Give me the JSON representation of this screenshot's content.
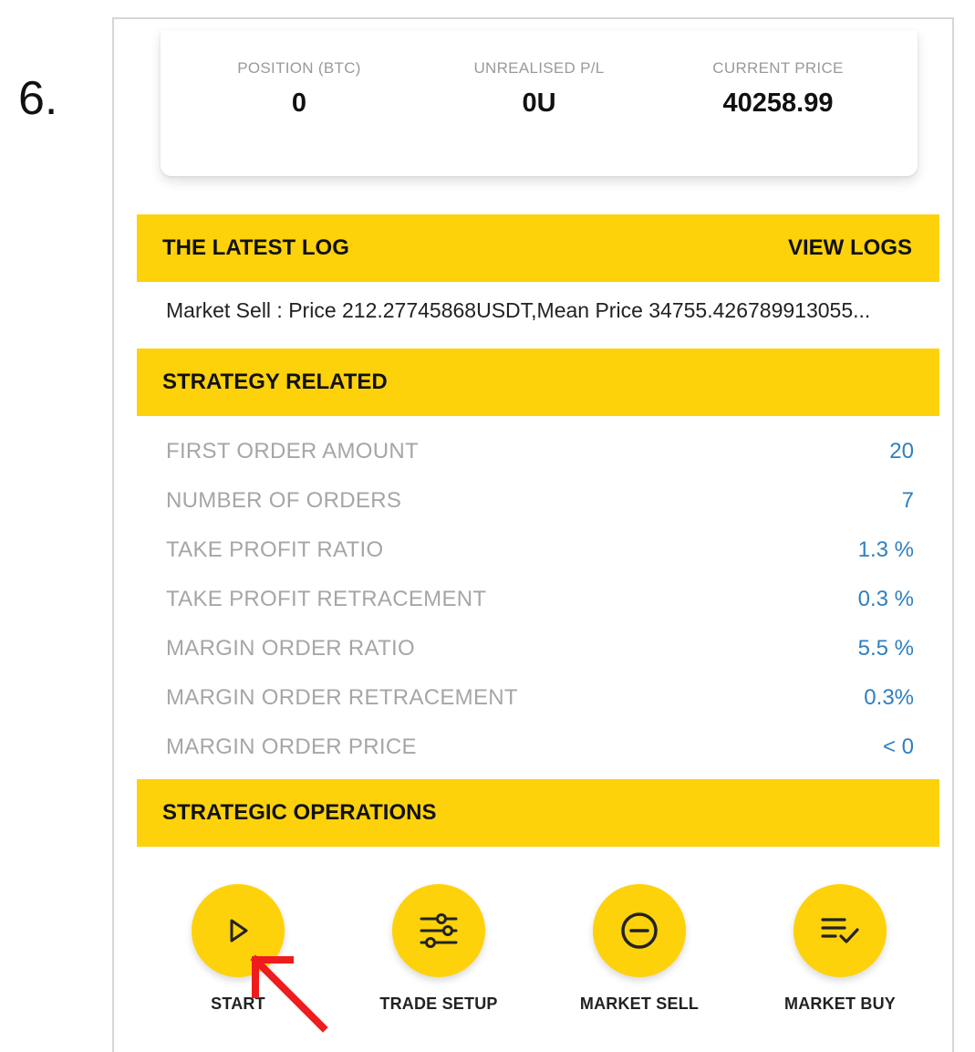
{
  "step_label": "6.",
  "summary": {
    "position_label": "POSITION (BTC)",
    "position_value": "0",
    "unrealised_label": "UNREALISED P/L",
    "unrealised_value": "0U",
    "price_label": "CURRENT PRICE",
    "price_value": "40258.99"
  },
  "latest_log": {
    "title": "THE LATEST LOG",
    "link": "VIEW LOGS",
    "entry": "Market Sell : Price 212.27745868USDT,Mean Price 34755.426789913055..."
  },
  "strategy": {
    "title": "STRATEGY RELATED",
    "params": [
      {
        "label": "FIRST ORDER AMOUNT",
        "value": "20"
      },
      {
        "label": "NUMBER OF ORDERS",
        "value": "7"
      },
      {
        "label": "TAKE PROFIT RATIO",
        "value": "1.3 %"
      },
      {
        "label": "TAKE PROFIT RETRACEMENT",
        "value": "0.3 %"
      },
      {
        "label": "MARGIN ORDER RATIO",
        "value": "5.5 %"
      },
      {
        "label": "MARGIN ORDER RETRACEMENT",
        "value": "0.3%"
      },
      {
        "label": "MARGIN ORDER PRICE",
        "value": "< 0"
      }
    ]
  },
  "operations": {
    "title": "STRATEGIC OPERATIONS",
    "buttons": [
      {
        "label": "START",
        "icon": "play-icon"
      },
      {
        "label": "TRADE SETUP",
        "icon": "sliders-icon"
      },
      {
        "label": "MARKET SELL",
        "icon": "minus-circle-icon"
      },
      {
        "label": "MARKET BUY",
        "icon": "list-check-icon"
      }
    ]
  },
  "colors": {
    "accent_yellow": "#fdd20a",
    "value_blue": "#2f7fbf",
    "label_gray": "#a6a6a6",
    "annotation_red": "#ee1c1c"
  }
}
